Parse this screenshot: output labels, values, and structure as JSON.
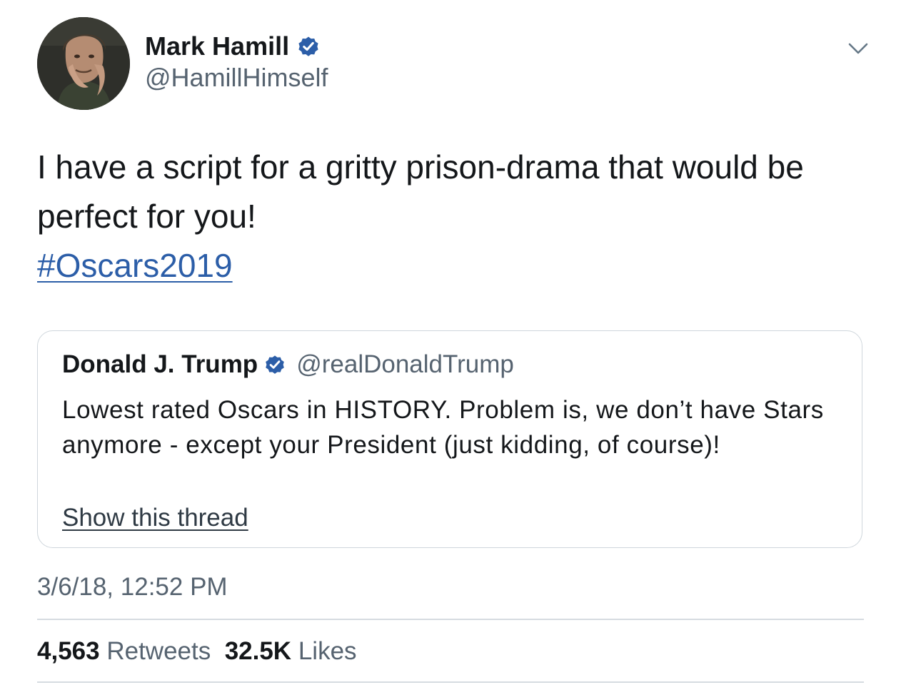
{
  "author": {
    "name": "Mark Hamill",
    "handle": "@HamillHimself",
    "verified": true,
    "avatar_icon": "profile-photo"
  },
  "tweet": {
    "text": "I have a script for a gritty prison-drama that would be perfect for you!",
    "hashtag": "#Oscars2019"
  },
  "quoted_tweet": {
    "name": "Donald J. Trump",
    "handle": "@realDonaldTrump",
    "verified": true,
    "text": "Lowest rated Oscars in HISTORY. Problem is, we don’t have Stars anymore - except your President (just kidding, of course)!",
    "show_thread": "Show this thread"
  },
  "timestamp": "3/6/18, 12:52 PM",
  "stats": {
    "retweets_count": "4,563",
    "retweets_label": "Retweets",
    "likes_count": "32.5K",
    "likes_label": "Likes"
  },
  "colors": {
    "link": "#2c5ea8",
    "verified_badge": "#2c5ea8",
    "secondary_text": "#566370",
    "border": "#cfd6dc"
  }
}
